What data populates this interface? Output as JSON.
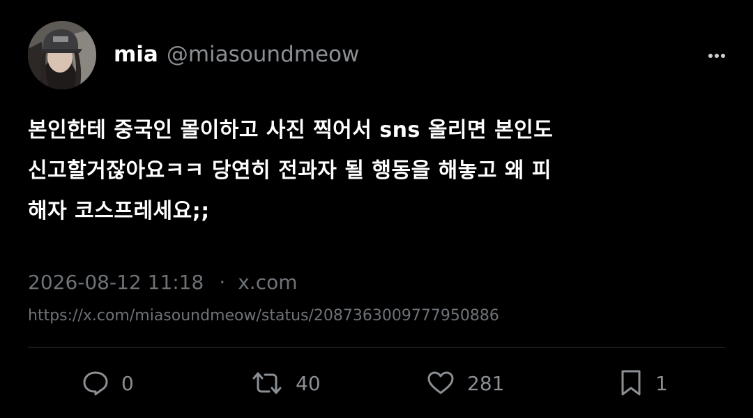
{
  "tweet": {
    "display_name": "mia",
    "handle": "@miasoundmeow",
    "text_lines": [
      "본인한테 중국인 몰이하고 사진 찍어서 sns 올리면 본인도",
      "신고할거잖아요ㅋㅋ 당연히 전과자 될 행동을 해놓고 왜 피",
      "해자 코스프레세요;;"
    ],
    "timestamp": "2026-08-12 11:18",
    "separator": "·",
    "source": "x.com",
    "url": "https://x.com/miasoundmeow/status/2087363009777950886"
  },
  "actions": {
    "reply": {
      "icon": "reply-icon",
      "count": "0"
    },
    "retweet": {
      "icon": "retweet-icon",
      "count": "40"
    },
    "like": {
      "icon": "heart-icon",
      "count": "281"
    },
    "bookmark": {
      "icon": "bookmark-icon",
      "count": "1"
    }
  },
  "colors": {
    "background": "#000000",
    "primary_text": "#ffffff",
    "secondary_text": "#8b8f94",
    "meta_text": "#6e7378",
    "divider": "#2f3336"
  }
}
